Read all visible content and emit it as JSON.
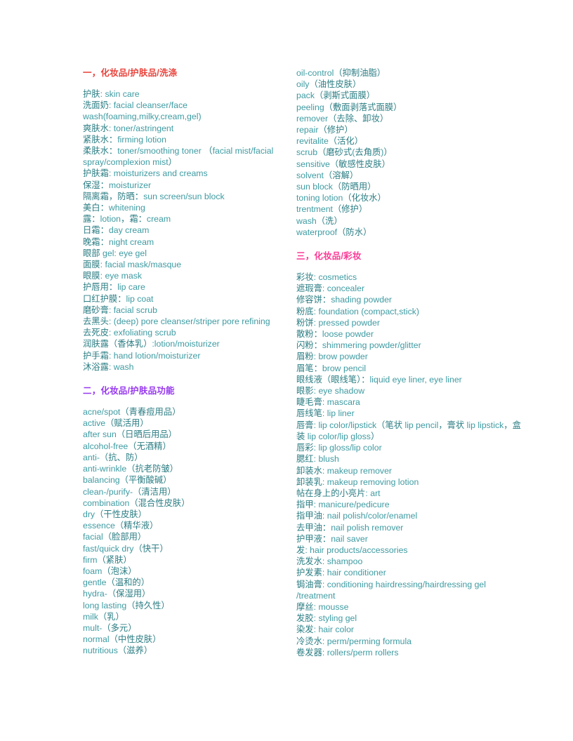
{
  "document": {
    "title": "化妆品/护肤品/彩妆 英语词汇对照",
    "colors": {
      "heading_one": "#e8433b",
      "heading_two": "#9637ee",
      "heading_three": "#fb3a96",
      "body_chinese": "#2c7e84",
      "body_english": "#3e9ba2",
      "background": "#ffffff"
    }
  },
  "sections": [
    {
      "id": "section-one",
      "heading": "一，化妆品/护肤品/洗涤",
      "column": "left",
      "entries": [
        "护肤: skin care",
        "洗面奶: facial cleanser/face wash(foaming,milky,cream,gel)",
        "爽肤水: toner/astringent",
        "紧肤水：firming lotion",
        "柔肤水：toner/smoothing toner （facial mist/facial spray/complexion mist）",
        "护肤霜: moisturizers and creams",
        "保湿：moisturizer",
        "隔离霜，防晒：sun screen/sun block",
        "美白：whitening",
        "露：lotion，霜：cream",
        "日霜：day cream",
        "晚霜：night cream",
        "眼部 gel: eye gel",
        "面膜: facial mask/masque",
        "眼膜: eye mask",
        "护唇用：lip care",
        "口红护膜：lip coat",
        "磨砂膏: facial scrub",
        "去黑头: (deep) pore cleanser/striper pore refining",
        "去死皮: exfoliating scrub",
        "润肤露（香体乳）:lotion/moisturizer",
        "护手霜: hand lotion/moisturizer",
        "沐浴露: wash"
      ]
    },
    {
      "id": "section-two",
      "heading": "二，化妆品/护肤品功能",
      "column": "left",
      "entries": [
        "acne/spot（青春痘用品）",
        "active（赋活用）",
        "after sun（日晒后用品）",
        "alcohol-free（无酒精）",
        "anti-（抗、防）",
        "anti-wrinkle（抗老防皱）",
        "balancing（平衡酸碱）",
        "clean-/purify-（清洁用）",
        "combination（混合性皮肤）",
        "dry（干性皮肤）",
        "essence（精华液）",
        "facial（脸部用）",
        "fast/quick dry（快干）",
        "firm（紧肤）",
        "foam（泡沫）",
        "gentle（温和的）",
        "hydra-（保湿用）",
        "long lasting（持久性）",
        "milk（乳）",
        "mult-（多元）",
        "normal（中性皮肤）",
        "nutritious（滋养）"
      ]
    },
    {
      "id": "section-two-continued",
      "heading": "",
      "column": "right",
      "entries": [
        "oil-control（抑制油脂）",
        "oily（油性皮肤）",
        "pack（剥斯式面膜）",
        "peeling（敷面剥落式面膜）",
        "remover（去除、卸妆）",
        "repair（修护）",
        "revitalite（活化）",
        "scrub（磨砂式(去角质)）",
        "sensitive（敏感性皮肤）",
        "solvent（溶解）",
        "sun block（防晒用）",
        "toning lotion（化妆水）",
        "trentment（修护）",
        "wash（洗）",
        "waterproof（防水）"
      ]
    },
    {
      "id": "section-three",
      "heading": "三，化妆品/彩妆",
      "column": "right",
      "entries": [
        "彩妆: cosmetics",
        "遮瑕膏: concealer",
        "修容饼：shading powder",
        "粉底: foundation (compact,stick)",
        "粉饼: pressed powder",
        "散粉：loose powder",
        "闪粉：shimmering powder/glitter",
        "眉粉: brow powder",
        "眉笔：brow pencil",
        "眼线液（眼线笔）：liquid eye liner, eye liner",
        "眼影: eye shadow",
        "睫毛膏: mascara",
        "唇线笔: lip liner",
        "唇膏: lip color/lipstick（笔状 lip pencil，膏状 lip lipstick，盒装 lip color/lip gloss）",
        "唇彩: lip gloss/lip color",
        "腮红: blush",
        "卸装水: makeup remover",
        "卸装乳: makeup removing lotion",
        "帖在身上的小亮片: art",
        "指甲: manicure/pedicure",
        "指甲油: nail polish/color/enamel",
        "去甲油：nail polish remover",
        "护甲液：nail saver",
        "发: hair products/accessories",
        "洗发水: shampoo",
        "护发素: hair conditioner",
        "锔油膏: conditioning hairdressing/hairdressing gel /treatment",
        "摩丝: mousse",
        "发胶: styling gel",
        "染发: hair color",
        "冷烫水: perm/perming formula",
        "卷发器: rollers/perm rollers"
      ]
    }
  ]
}
